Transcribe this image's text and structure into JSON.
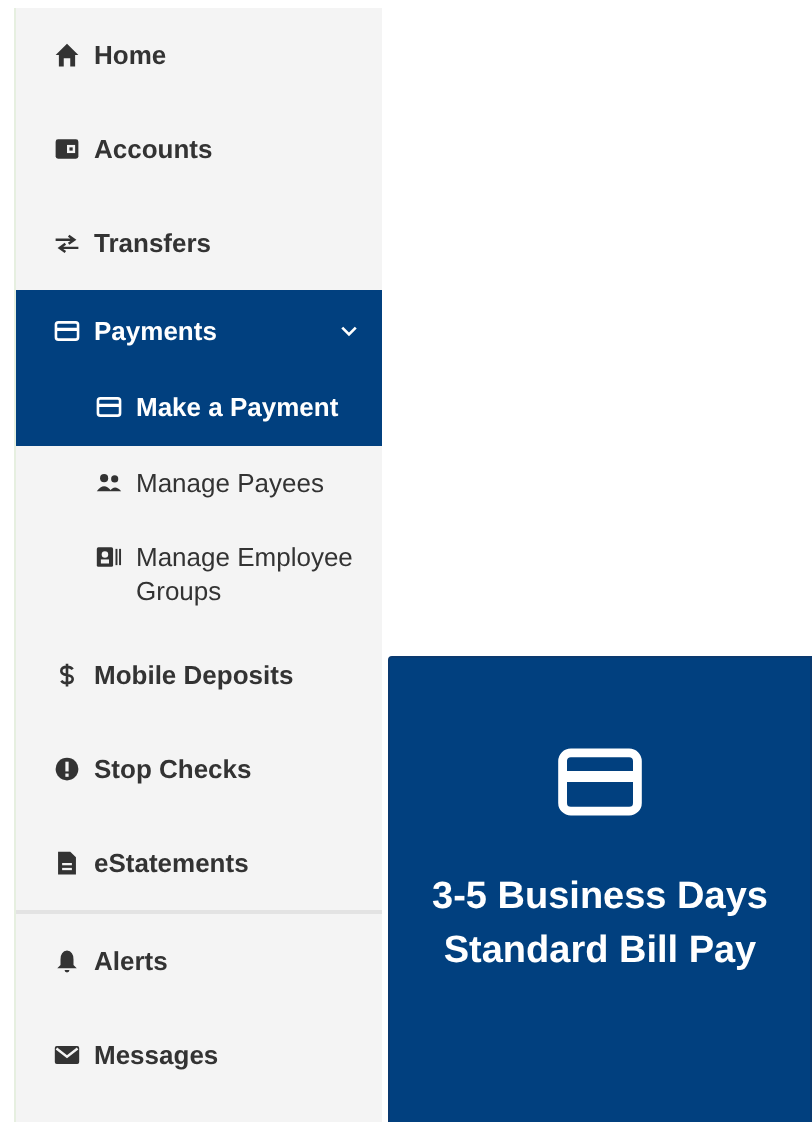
{
  "sidebar": {
    "sections": [
      {
        "items": [
          {
            "label": "Home",
            "selected": false
          },
          {
            "label": "Accounts",
            "selected": false
          },
          {
            "label": "Transfers",
            "selected": false
          },
          {
            "label": "Payments",
            "selected": true,
            "expanded": true,
            "children": [
              {
                "label": "Make a Payment",
                "selected": true
              },
              {
                "label": "Manage Payees",
                "selected": false
              },
              {
                "label": "Manage Employee Groups",
                "selected": false
              }
            ]
          },
          {
            "label": "Mobile Deposits",
            "selected": false
          },
          {
            "label": "Stop Checks",
            "selected": false
          },
          {
            "label": "eStatements",
            "selected": false
          }
        ]
      },
      {
        "items": [
          {
            "label": "Alerts",
            "selected": false
          },
          {
            "label": "Messages",
            "selected": false
          }
        ]
      }
    ]
  },
  "card": {
    "title": "3-5 Business Days Standard Bill Pay"
  }
}
